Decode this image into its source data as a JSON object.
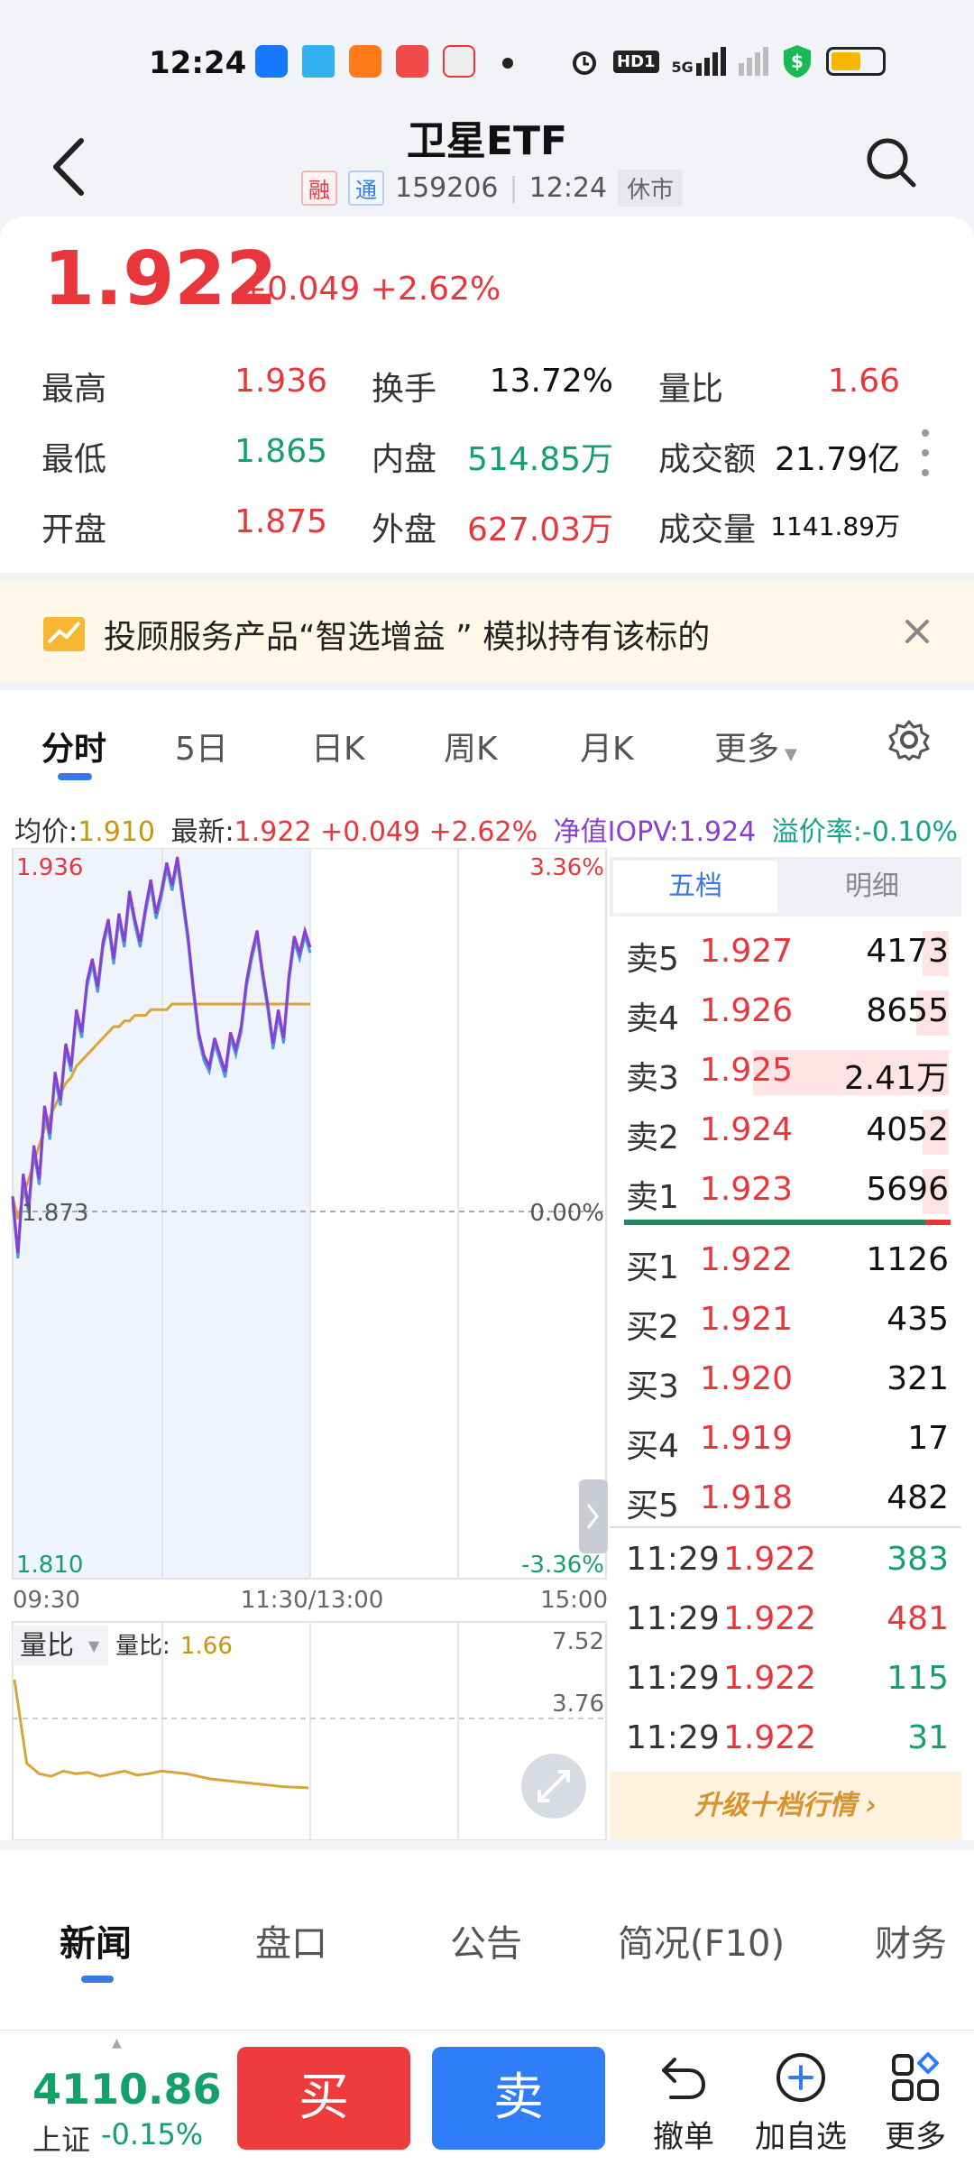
{
  "status": {
    "time": "12:24",
    "network": "5G",
    "hd": "HD1"
  },
  "header": {
    "title": "卫星ETF",
    "tag_rong": "融",
    "tag_tong": "通",
    "code": "159206",
    "time": "12:24",
    "state": "休市"
  },
  "quote": {
    "price": "1.922",
    "change": "+0.049 +2.62%",
    "stats": [
      {
        "label": "最高",
        "value": "1.936",
        "color": "red"
      },
      {
        "label": "换手",
        "value": "13.72%",
        "color": "black"
      },
      {
        "label": "量比",
        "value": "1.66",
        "color": "red"
      },
      {
        "label": "最低",
        "value": "1.865",
        "color": "green"
      },
      {
        "label": "内盘",
        "value": "514.85万",
        "color": "green"
      },
      {
        "label": "成交额",
        "value": "21.79亿",
        "color": "black"
      },
      {
        "label": "开盘",
        "value": "1.875",
        "color": "red"
      },
      {
        "label": "外盘",
        "value": "627.03万",
        "color": "red"
      },
      {
        "label": "成交量",
        "value": "1141.89万",
        "color": "black"
      }
    ]
  },
  "banner": {
    "text": "投顾服务产品“智选增益 ” 模拟持有该标的"
  },
  "tabs": [
    "分时",
    "5日",
    "日K",
    "周K",
    "月K",
    "更多"
  ],
  "info_line": {
    "avg_label": "均价:",
    "avg_value": "1.910",
    "last_label": "最新:",
    "last_value": "1.922 +0.049 +2.62%",
    "iopv": "净值IOPV:1.924",
    "premium": "溢价率:-0.10%"
  },
  "chart_data": {
    "type": "line",
    "title": "",
    "y_max_label": "1.936",
    "y_mid_label": "1.873",
    "y_min_label": "1.810",
    "pct_max_label": "3.36%",
    "pct_mid_label": "0.00%",
    "pct_min_label": "-3.36%",
    "x_labels": [
      "09:30",
      "11:30/13:00",
      "15:00"
    ],
    "ylim": [
      1.81,
      1.936
    ],
    "prev_close": 1.873,
    "series": [
      {
        "values": [
          1.876,
          1.866,
          1.88,
          1.874,
          1.885,
          1.879,
          1.892,
          1.887,
          1.898,
          1.893,
          1.903,
          1.899,
          1.909,
          1.905,
          1.914,
          1.918,
          1.913,
          1.921,
          1.925,
          1.918,
          1.926,
          1.921,
          1.93,
          1.925,
          1.921,
          1.927,
          1.932,
          1.926,
          1.93,
          1.935,
          1.931,
          1.936,
          1.929,
          1.922,
          1.913,
          1.905,
          1.901,
          1.899,
          1.904,
          1.901,
          1.898,
          1.905,
          1.902,
          1.906,
          1.914,
          1.919,
          1.923,
          1.916,
          1.91,
          1.903,
          1.909,
          1.904,
          1.915,
          1.922,
          1.919,
          1.923,
          1.92
        ]
      },
      {
        "values": [
          1.876,
          1.872,
          1.876,
          1.879,
          1.882,
          1.885,
          1.888,
          1.89,
          1.892,
          1.894,
          1.896,
          1.897,
          1.899,
          1.9,
          1.901,
          1.902,
          1.903,
          1.904,
          1.905,
          1.906,
          1.906,
          1.907,
          1.907,
          1.908,
          1.908,
          1.908,
          1.909,
          1.909,
          1.909,
          1.909,
          1.91,
          1.91,
          1.91,
          1.91,
          1.91,
          1.91,
          1.91,
          1.91,
          1.91,
          1.91,
          1.91,
          1.91,
          1.91,
          1.91,
          1.91,
          1.91,
          1.91,
          1.91,
          1.91,
          1.91,
          1.91,
          1.91,
          1.91,
          1.91,
          1.91,
          1.91,
          1.91
        ]
      }
    ],
    "volume_ratio": {
      "label": "量比",
      "value_label": "量比:",
      "value": "1.66",
      "ticks": [
        "7.52",
        "3.76"
      ],
      "ylim": [
        0,
        7.52
      ],
      "values": [
        5.8,
        2.6,
        2.2,
        2.1,
        2.3,
        2.2,
        2.25,
        2.1,
        2.2,
        2.3,
        2.15,
        2.2,
        2.3,
        2.25,
        2.2,
        2.1,
        2.0,
        1.95,
        1.9,
        1.85,
        1.8,
        1.75,
        1.7,
        1.68,
        1.66
      ]
    }
  },
  "orderbook": {
    "tab_five": "五档",
    "tab_detail": "明细",
    "asks": [
      {
        "label": "卖5",
        "price": "1.927",
        "qty": "4173",
        "frac": 0.08
      },
      {
        "label": "卖4",
        "price": "1.926",
        "qty": "8655",
        "frac": 0.1
      },
      {
        "label": "卖3",
        "price": "1.925",
        "qty": "2.41万",
        "frac": 0.6
      },
      {
        "label": "卖2",
        "price": "1.924",
        "qty": "4052",
        "frac": 0.08
      },
      {
        "label": "卖1",
        "price": "1.923",
        "qty": "5696",
        "frac": 0.08
      }
    ],
    "bids": [
      {
        "label": "买1",
        "price": "1.922",
        "qty": "1126"
      },
      {
        "label": "买2",
        "price": "1.921",
        "qty": "435"
      },
      {
        "label": "买3",
        "price": "1.920",
        "qty": "321"
      },
      {
        "label": "买4",
        "price": "1.919",
        "qty": "17"
      },
      {
        "label": "买5",
        "price": "1.918",
        "qty": "482"
      }
    ],
    "trades": [
      {
        "time": "11:29",
        "price": "1.922",
        "qty": "383",
        "color": "green"
      },
      {
        "time": "11:29",
        "price": "1.922",
        "qty": "481",
        "color": "red"
      },
      {
        "time": "11:29",
        "price": "1.922",
        "qty": "115",
        "color": "green"
      },
      {
        "time": "11:29",
        "price": "1.922",
        "qty": "31",
        "color": "green"
      }
    ],
    "upgrade": "升级十档行情"
  },
  "news_tabs": [
    "新闻",
    "盘口",
    "公告",
    "简况(F10)",
    "财务"
  ],
  "bottom": {
    "index_value": "4110.86",
    "index_name": "上证",
    "index_change": "-0.15%",
    "buy": "买",
    "sell": "卖",
    "undo": "撤单",
    "add_watch": "加自选",
    "more": "更多"
  },
  "colors": {
    "red": "#e8373c",
    "green": "#13a06a",
    "blue": "#3b78e7",
    "price_line": "#8a3fd1",
    "price_line_2": "#4a9ae0",
    "avg_line": "#d9a53a"
  }
}
